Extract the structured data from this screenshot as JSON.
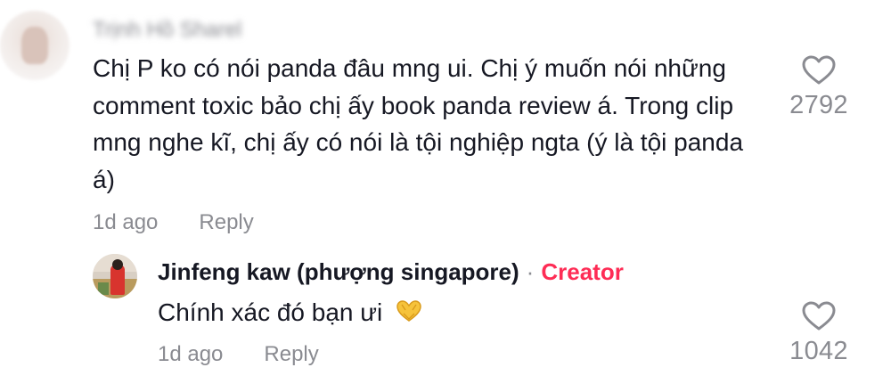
{
  "comment": {
    "username": "Trịnh Hồ Sharel",
    "text": "Chị P ko có nói panda đâu mng ui. Chị ý muốn nói những comment toxic bảo chị ấy book panda review á. Trong clip mng nghe kĩ, chị ấy có nói là tội nghiệp ngta (ý là tội panda á)",
    "time": "1d ago",
    "reply_label": "Reply",
    "like_count": "2792",
    "like_icon": "heart-outline-icon"
  },
  "reply": {
    "username": "Jinfeng kaw (phượng singapore)",
    "separator": "·",
    "badge": "Creator",
    "text": "Chính xác đó bạn ưi",
    "emoji_icon": "heart-hands-emoji",
    "time": "1d ago",
    "reply_label": "Reply",
    "like_count": "1042",
    "like_icon": "heart-outline-icon"
  },
  "colors": {
    "text": "#161823",
    "muted": "#8a8b91",
    "creator": "#fe2c55"
  }
}
